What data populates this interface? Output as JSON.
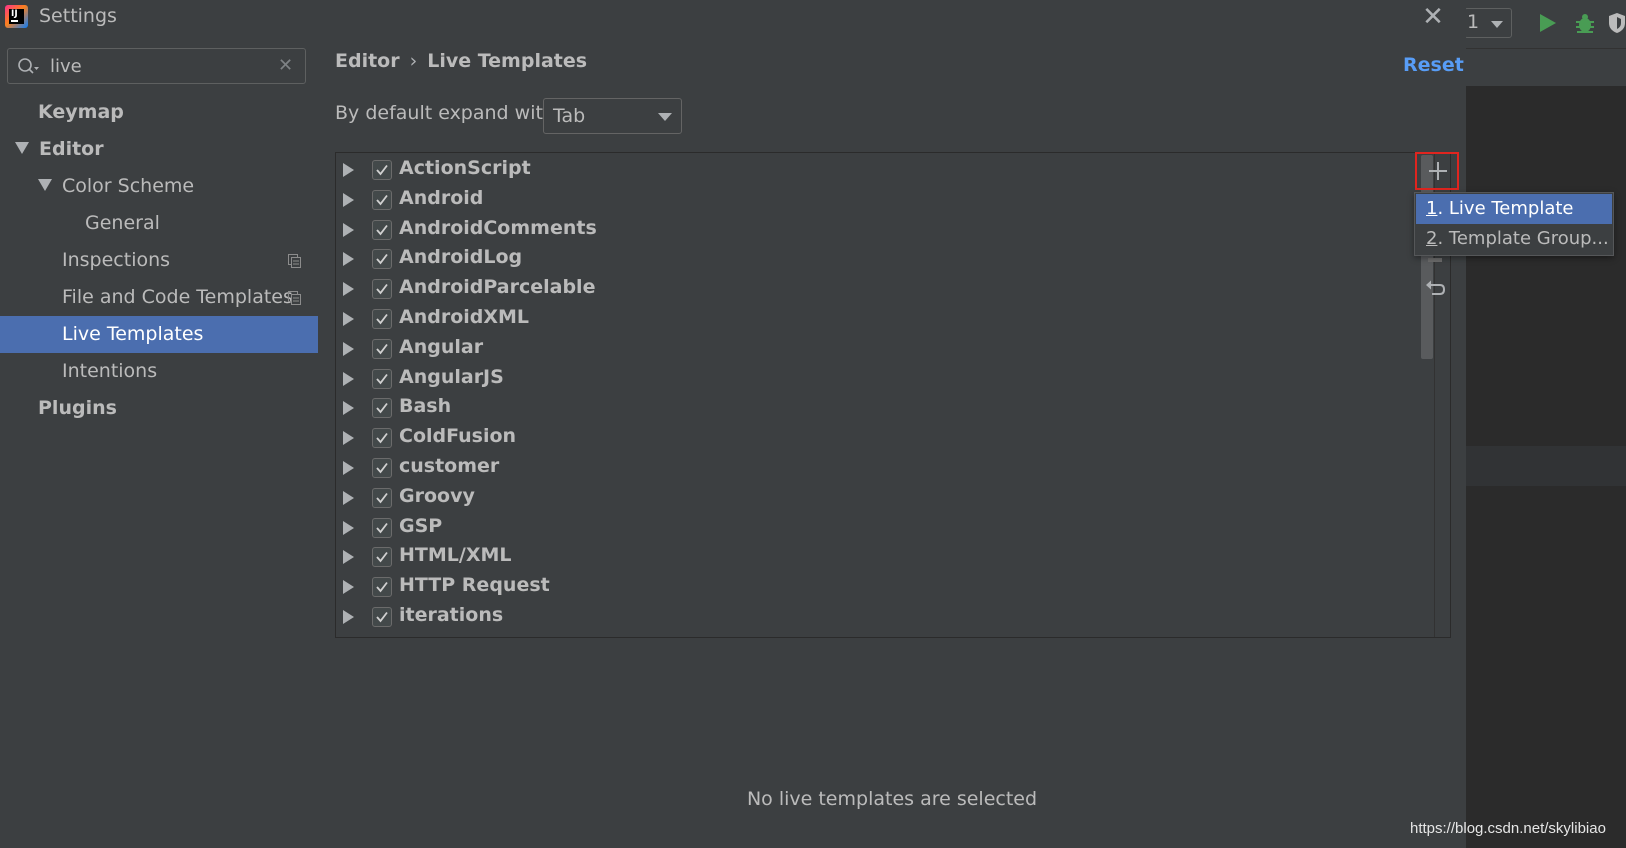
{
  "window": {
    "title": "Settings",
    "close_glyph": "✕"
  },
  "search": {
    "value": "live",
    "placeholder": ""
  },
  "sidebar": {
    "items": [
      {
        "label": "Keymap"
      },
      {
        "label": "Editor"
      },
      {
        "label": "Color Scheme"
      },
      {
        "label": "General"
      },
      {
        "label": "Inspections"
      },
      {
        "label": "File and Code Templates"
      },
      {
        "label": "Live Templates"
      },
      {
        "label": "Intentions"
      },
      {
        "label": "Plugins"
      }
    ]
  },
  "header": {
    "breadcrumb_parent": "Editor",
    "breadcrumb_sep": "›",
    "breadcrumb_current": "Live Templates",
    "reset_label": "Reset"
  },
  "expand": {
    "label": "By default expand with",
    "selected": "Tab"
  },
  "template_groups": [
    {
      "label": "ActionScript",
      "checked": true
    },
    {
      "label": "Android",
      "checked": true
    },
    {
      "label": "AndroidComments",
      "checked": true
    },
    {
      "label": "AndroidLog",
      "checked": true
    },
    {
      "label": "AndroidParcelable",
      "checked": true
    },
    {
      "label": "AndroidXML",
      "checked": true
    },
    {
      "label": "Angular",
      "checked": true
    },
    {
      "label": "AngularJS",
      "checked": true
    },
    {
      "label": "Bash",
      "checked": true
    },
    {
      "label": "ColdFusion",
      "checked": true
    },
    {
      "label": "customer",
      "checked": true
    },
    {
      "label": "Groovy",
      "checked": true
    },
    {
      "label": "GSP",
      "checked": true
    },
    {
      "label": "HTML/XML",
      "checked": true
    },
    {
      "label": "HTTP Request",
      "checked": true
    },
    {
      "label": "iterations",
      "checked": true
    }
  ],
  "add_menu": {
    "items": [
      {
        "mnemonic": "1",
        "label": ". Live Template"
      },
      {
        "mnemonic": "2",
        "label": ". Template Group..."
      }
    ]
  },
  "empty_message": "No live templates are selected",
  "ide": {
    "run_config": "1"
  },
  "watermark": "https://blog.csdn.net/skylibiao",
  "colors": {
    "selection": "#4b6eaf",
    "link": "#589df6",
    "highlight_border": "#e0251f",
    "run_green": "#499c54"
  },
  "icons": [
    "search-icon",
    "clear-icon",
    "copy-icon",
    "plus-icon",
    "undo-icon",
    "run-icon",
    "debug-icon",
    "coverage-icon"
  ]
}
